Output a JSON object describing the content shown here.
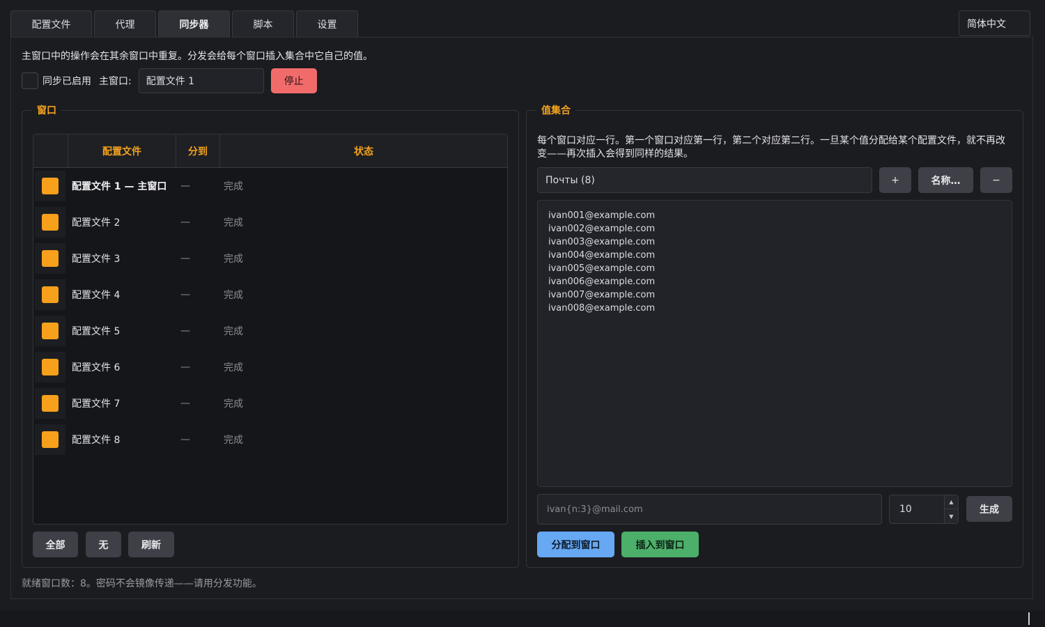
{
  "tabs": [
    {
      "label": "配置文件"
    },
    {
      "label": "代理"
    },
    {
      "label": "同步器"
    },
    {
      "label": "脚本"
    },
    {
      "label": "设置"
    }
  ],
  "active_tab": "同步器",
  "language": "简体中文",
  "description": "主窗口中的操作会在其余窗口中重复。分发会给每个窗口插入集合中它自己的值。",
  "sync": {
    "enabled_label": "同步已启用",
    "main_window_label": "主窗口:",
    "main_window_value": "配置文件 1",
    "stop_label": "停止"
  },
  "windows": {
    "title": "窗口",
    "columns": {
      "profile": "配置文件",
      "assigned": "分到",
      "status": "状态"
    },
    "rows": [
      {
        "name": "配置文件 1  — 主窗口",
        "assigned": "—",
        "status": "完成"
      },
      {
        "name": "配置文件 2",
        "assigned": "—",
        "status": "完成"
      },
      {
        "name": "配置文件 3",
        "assigned": "—",
        "status": "完成"
      },
      {
        "name": "配置文件 4",
        "assigned": "—",
        "status": "完成"
      },
      {
        "name": "配置文件 5",
        "assigned": "—",
        "status": "完成"
      },
      {
        "name": "配置文件 6",
        "assigned": "—",
        "status": "完成"
      },
      {
        "name": "配置文件 7",
        "assigned": "—",
        "status": "完成"
      },
      {
        "name": "配置文件 8",
        "assigned": "—",
        "status": "完成"
      }
    ],
    "buttons": {
      "all": "全部",
      "none": "无",
      "refresh": "刷新"
    }
  },
  "value_sets": {
    "title": "值集合",
    "description": "每个窗口对应一行。第一个窗口对应第一行，第二个对应第二行。一旦某个值分配给某个配置文件，就不再改变——再次插入会得到同样的结果。",
    "selected_set": "Почты (8)",
    "add_label": "+",
    "rename_label": "名称…",
    "remove_label": "−",
    "values": [
      "ivan001@example.com",
      "ivan002@example.com",
      "ivan003@example.com",
      "ivan004@example.com",
      "ivan005@example.com",
      "ivan006@example.com",
      "ivan007@example.com",
      "ivan008@example.com"
    ],
    "pattern_placeholder": "ivan{n:3}@mail.com",
    "count": "10",
    "generate_label": "生成",
    "distribute_label": "分配到窗口",
    "insert_label": "插入到窗口"
  },
  "footer": "就绪窗口数：8。密码不会镜像传递——请用分发功能。",
  "colors": {
    "accent": "#f3a21e",
    "stop": "#f26b6b",
    "distribute": "#66a8f2",
    "insert": "#4caf6a",
    "checkbox_fill": "#f6a01b"
  }
}
